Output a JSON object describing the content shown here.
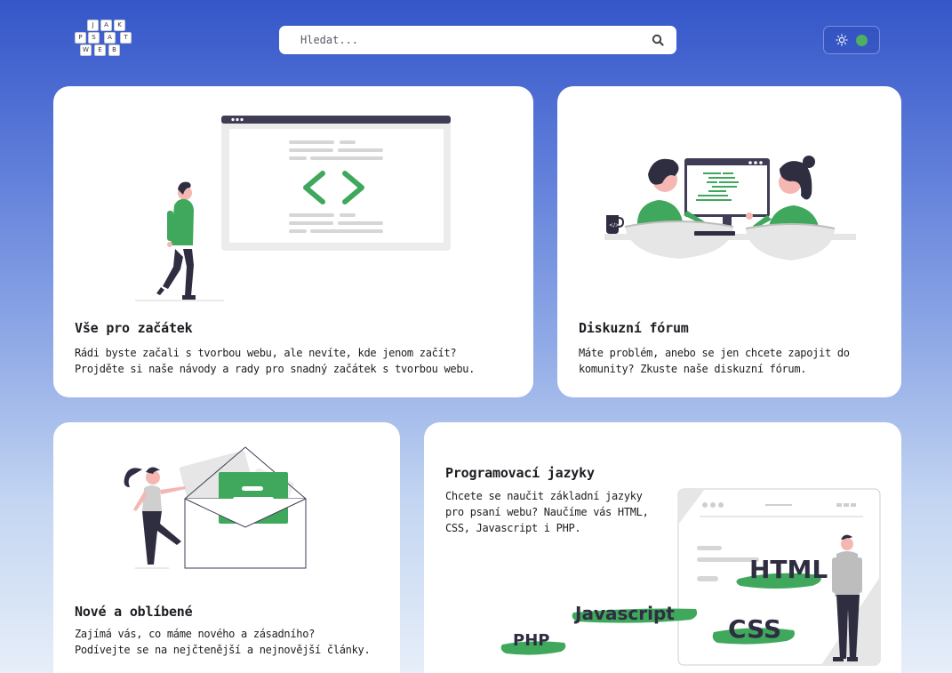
{
  "logo": {
    "keys": [
      "J",
      "A",
      "K",
      "P",
      "S",
      "A",
      "T",
      "W",
      "E",
      "B"
    ]
  },
  "search": {
    "placeholder": "Hledat...",
    "icon": "search-icon"
  },
  "theme_toggle": {
    "icon": "sun-icon",
    "status_color": "#4caf61"
  },
  "colors": {
    "accent": "#3fa85c",
    "dark": "#2f2e41",
    "background_top": "#3456c8"
  },
  "cards": [
    {
      "title": "Vše pro začátek",
      "desc_line1": "Rádi byste začali s tvorbou webu, ale nevíte, kde jenom začít?",
      "desc_line2": "Projděte si naše návody a rady pro snadný začátek s tvorbou webu."
    },
    {
      "title": "Diskuzní fórum",
      "desc_line1": "Máte problém, anebo se jen chcete zapojit do",
      "desc_line2": "komunity? Zkuste naše diskuzní fórum."
    },
    {
      "title": "Nové a oblíbené",
      "desc_line1": "Zajímá vás, co máme nového a zásadního?",
      "desc_line2": "Podívejte se na nejčtenější a nejnovější články."
    },
    {
      "title": "Programovací jazyky",
      "desc_line1": "Chcete se naučit základní jazyky",
      "desc_line2": "pro psaní webu? Naučíme vás HTML,",
      "desc_line3": "CSS, Javascript i PHP.",
      "languages": [
        "HTML",
        "Javascript",
        "CSS",
        "PHP"
      ]
    }
  ]
}
